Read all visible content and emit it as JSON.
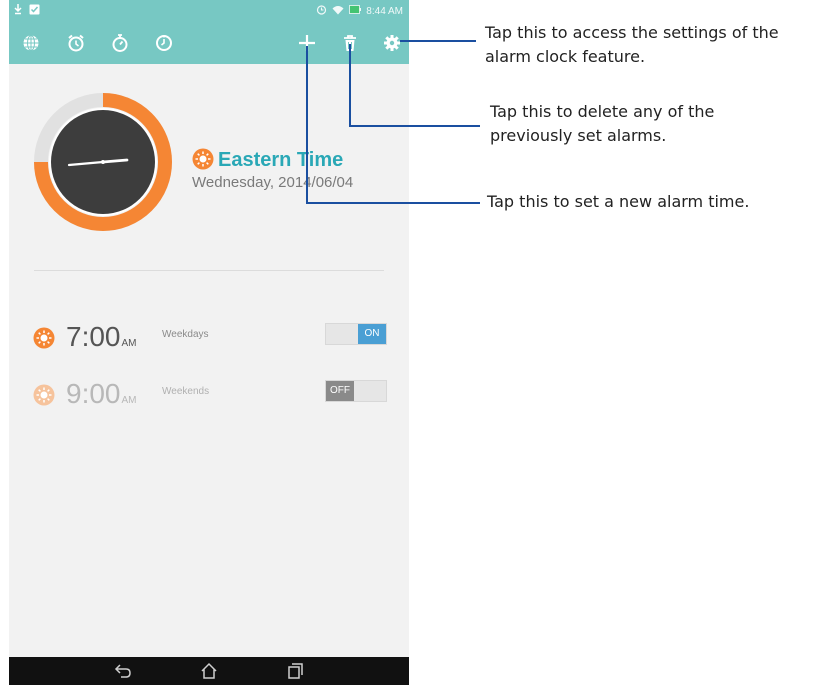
{
  "status_bar": {
    "time": "8:44 AM"
  },
  "toolbar": {
    "icons": [
      "world-clock-icon",
      "alarm-icon",
      "stopwatch-icon",
      "timer-icon",
      "add-icon",
      "delete-icon",
      "settings-icon"
    ]
  },
  "clock": {
    "timezone": "Eastern Time",
    "date": "Wednesday, 2014/06/04"
  },
  "alarms": [
    {
      "time": "7:00",
      "ampm": "AM",
      "label": "Weekdays",
      "toggle": "ON",
      "enabled": true
    },
    {
      "time": "9:00",
      "ampm": "AM",
      "label": "Weekends",
      "toggle": "OFF",
      "enabled": false
    }
  ],
  "callouts": {
    "settings": "Tap this to access the settings of the alarm clock feature.",
    "delete": "Tap this to delete any of the previously set alarms.",
    "add": "Tap this to set a new alarm time."
  },
  "colors": {
    "toolbar": "#77c8c3",
    "accent_orange": "#f58634",
    "timezone_text": "#2aa8b6",
    "toggle_on": "#4a9fd4",
    "callout_line": "#1a4fa0"
  }
}
